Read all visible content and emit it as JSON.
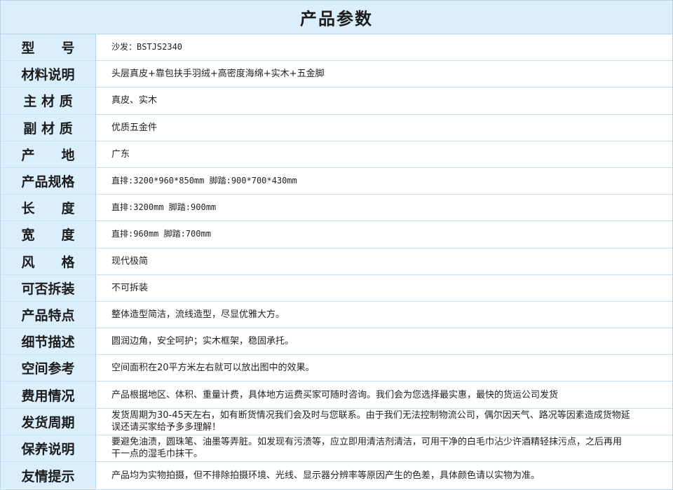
{
  "header": {
    "title": "产品参数"
  },
  "rows": [
    {
      "label": "型　　号",
      "value": "沙发：BSTJS2340"
    },
    {
      "label": "材料说明",
      "value": "头层真皮+靠包扶手羽绒+高密度海绵+实木+五金脚"
    },
    {
      "label": "主 材 质",
      "value": "真皮、实木"
    },
    {
      "label": "副 材 质",
      "value": "优质五金件"
    },
    {
      "label": "产　　地",
      "value": "广东"
    },
    {
      "label": "产品规格",
      "value": "直排:3200*960*850mm  脚踏:900*700*430mm"
    },
    {
      "label": "长　　度",
      "value": "直排:3200mm  脚踏:900mm"
    },
    {
      "label": "宽　　度",
      "value": "直排:960mm  脚踏:700mm"
    },
    {
      "label": "风　　格",
      "value": "现代极简"
    },
    {
      "label": "可否拆装",
      "value": "不可拆装"
    },
    {
      "label": "产品特点",
      "value": "整体造型简洁，流线造型，尽显优雅大方。"
    },
    {
      "label": "细节描述",
      "value": "圆润边角，安全呵护；实木框架，稳固承托。"
    },
    {
      "label": "空间参考",
      "value": "空间面积在20平方米左右就可以放出图中的效果。"
    },
    {
      "label": "费用情况",
      "value": "产品根据地区、体积、重量计费，具体地方运费买家可随时咨询。我们会为您选择最实惠，最快的货运公司发货"
    },
    {
      "label": "发货周期",
      "value": "发货周期为30-45天左右，如有断货情况我们会及时与您联系。由于我们无法控制物流公司，偶尔因天气、路况等因素造成货物延误还请买家给予多多理解！"
    },
    {
      "label": "保养说明",
      "value": "要避免油渍，圆珠笔、油墨等弄脏。如发现有污渍等，应立即用清洁剂清洁，可用干净的白毛巾沾少许酒精轻抹污点，之后再用干一点的湿毛巾抹干。"
    },
    {
      "label": "友情提示",
      "value": "产品均为实物拍摄，但不排除拍摄环境、光线、显示器分辨率等原因产生的色差，具体颜色请以实物为准。"
    }
  ]
}
